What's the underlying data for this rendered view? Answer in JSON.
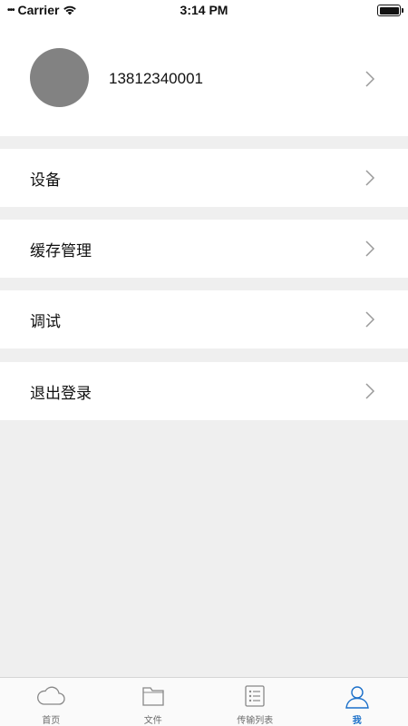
{
  "status_bar": {
    "carrier": "Carrier",
    "time": "3:14 PM"
  },
  "profile": {
    "phone": "13812340001"
  },
  "menu": [
    {
      "label": "设备"
    },
    {
      "label": "缓存管理"
    },
    {
      "label": "调试"
    },
    {
      "label": "退出登录"
    }
  ],
  "tabbar": {
    "active_color": "#1a6fc9",
    "tabs": [
      {
        "label": "首页",
        "icon": "cloud-icon"
      },
      {
        "label": "文件",
        "icon": "folder-icon"
      },
      {
        "label": "传输列表",
        "icon": "list-icon"
      },
      {
        "label": "我",
        "icon": "user-icon",
        "active": true
      }
    ]
  }
}
